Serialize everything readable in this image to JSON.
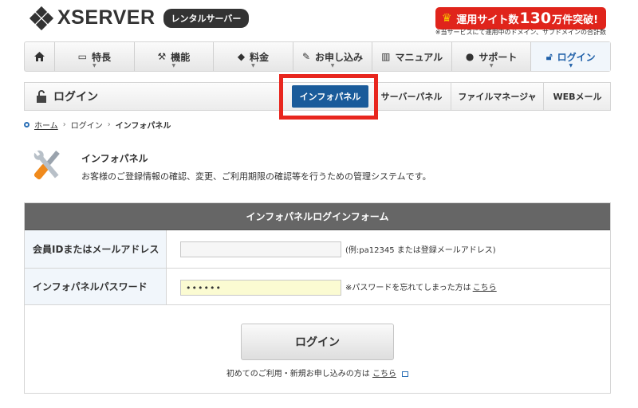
{
  "header": {
    "logo_text": "XSERVER",
    "logo_badge": "レンタルサーバー",
    "promo_prefix": "運用サイト数",
    "promo_number": "130",
    "promo_suffix": "万件突破!",
    "promo_note": "※当サービスにて運用中のドメイン、サブドメインの合計数"
  },
  "gnav": {
    "items": [
      {
        "label": "",
        "icon": "home-icon"
      },
      {
        "label": "特長",
        "icon": "monitor-icon"
      },
      {
        "label": "機能",
        "icon": "tools-icon"
      },
      {
        "label": "料金",
        "icon": "price-tag-icon"
      },
      {
        "label": "お申し込み",
        "icon": "pencil-icon"
      },
      {
        "label": "マニュアル",
        "icon": "book-icon"
      },
      {
        "label": "サポート",
        "icon": "person-icon"
      },
      {
        "label": "ログイン",
        "icon": "unlock-icon",
        "active": true
      }
    ]
  },
  "subbar": {
    "title": "ログイン",
    "tabs": [
      "インフォパネル",
      "サーバーパネル",
      "ファイルマネージャ",
      "WEBメール"
    ]
  },
  "breadcrumb": {
    "home": "ホーム",
    "login": "ログイン",
    "current": "インフォパネル"
  },
  "intro": {
    "title": "インフォパネル",
    "description": "お客様のご登録情報の確認、変更、ご利用期限の確認等を行うための管理システムです。"
  },
  "form": {
    "heading": "インフォパネルログインフォーム",
    "id_label": "会員IDまたはメールアドレス",
    "id_value": "",
    "id_note": "(例:pa12345 または登録メールアドレス)",
    "pw_label": "インフォパネルパスワード",
    "pw_value": "••••••",
    "pw_note": "※パスワードを忘れてしまった方は",
    "pw_link": "こちら",
    "login_button": "ログイン",
    "first_note": "初めてのご利用・新規お申し込みの方は",
    "first_link": "こちら"
  },
  "colors": {
    "accent": "#1a5b9a",
    "highlight": "#e8261e",
    "promo": "#e0241b"
  }
}
